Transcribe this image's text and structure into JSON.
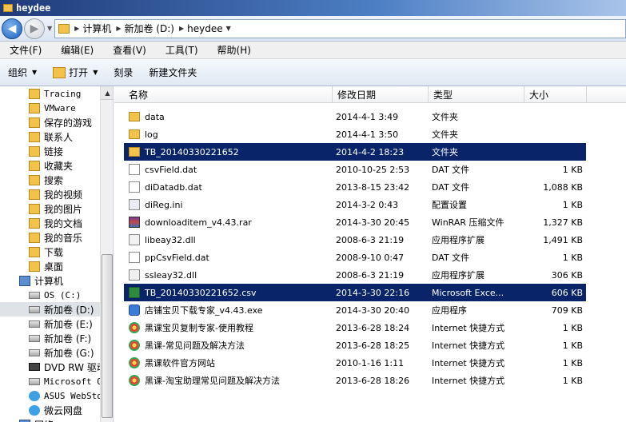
{
  "window": {
    "title": "heydee"
  },
  "address": {
    "crumbs": [
      "计算机",
      "新加卷 (D:)",
      "heydee"
    ]
  },
  "menu": [
    "文件(F)",
    "编辑(E)",
    "查看(V)",
    "工具(T)",
    "帮助(H)"
  ],
  "toolbar": {
    "organize": "组织",
    "open": "打开",
    "burn": "刻录",
    "new_folder": "新建文件夹"
  },
  "nav": [
    {
      "label": "Tracing",
      "icon": "folder-icon",
      "mono": true
    },
    {
      "label": "VMware",
      "icon": "folder-icon",
      "mono": true
    },
    {
      "label": "保存的游戏",
      "icon": "folder-icon"
    },
    {
      "label": "联系人",
      "icon": "folder-icon"
    },
    {
      "label": "链接",
      "icon": "folder-icon"
    },
    {
      "label": "收藏夹",
      "icon": "folder-icon"
    },
    {
      "label": "搜索",
      "icon": "folder-icon"
    },
    {
      "label": "我的视频",
      "icon": "folder-icon"
    },
    {
      "label": "我的图片",
      "icon": "folder-icon"
    },
    {
      "label": "我的文档",
      "icon": "folder-icon"
    },
    {
      "label": "我的音乐",
      "icon": "folder-icon"
    },
    {
      "label": "下载",
      "icon": "folder-icon"
    },
    {
      "label": "桌面",
      "icon": "folder-icon"
    },
    {
      "label": "计算机",
      "icon": "computer-icon"
    },
    {
      "label": "OS (C:)",
      "icon": "drive-icon",
      "mono": true
    },
    {
      "label": "新加卷 (D:)",
      "icon": "drive-icon",
      "selected": true
    },
    {
      "label": "新加卷 (E:)",
      "icon": "drive-icon"
    },
    {
      "label": "新加卷 (F:)",
      "icon": "drive-icon"
    },
    {
      "label": "新加卷 (G:)",
      "icon": "drive-icon"
    },
    {
      "label": "DVD RW 驱动",
      "icon": "dvd-icon"
    },
    {
      "label": "Microsoft O",
      "icon": "drive-icon",
      "mono": true
    },
    {
      "label": "ASUS WebSto",
      "icon": "cloud-icon",
      "mono": true
    },
    {
      "label": "微云网盘",
      "icon": "cloud-icon"
    },
    {
      "label": "网络",
      "icon": "computer-icon"
    }
  ],
  "columns": {
    "name": "名称",
    "date": "修改日期",
    "type": "类型",
    "size": "大小"
  },
  "files": [
    {
      "name": "data",
      "date": "2014-4-1 3:49",
      "type": "文件夹",
      "size": "",
      "icon": "folder"
    },
    {
      "name": "log",
      "date": "2014-4-1 3:50",
      "type": "文件夹",
      "size": "",
      "icon": "folder"
    },
    {
      "name": "TB_20140330221652",
      "date": "2014-4-2 18:23",
      "type": "文件夹",
      "size": "",
      "icon": "folder",
      "selected": true
    },
    {
      "name": "csvField.dat",
      "date": "2010-10-25 2:53",
      "type": "DAT 文件",
      "size": "1 KB",
      "icon": "file"
    },
    {
      "name": "diDatadb.dat",
      "date": "2013-8-15 23:42",
      "type": "DAT 文件",
      "size": "1,088 KB",
      "icon": "file"
    },
    {
      "name": "diReg.ini",
      "date": "2014-3-2 0:43",
      "type": "配置设置",
      "size": "1 KB",
      "icon": "ini"
    },
    {
      "name": "downloaditem_v4.43.rar",
      "date": "2014-3-30 20:45",
      "type": "WinRAR 压缩文件",
      "size": "1,327 KB",
      "icon": "rar"
    },
    {
      "name": "libeay32.dll",
      "date": "2008-6-3 21:19",
      "type": "应用程序扩展",
      "size": "1,491 KB",
      "icon": "dll"
    },
    {
      "name": "ppCsvField.dat",
      "date": "2008-9-10 0:47",
      "type": "DAT 文件",
      "size": "1 KB",
      "icon": "file"
    },
    {
      "name": "ssleay32.dll",
      "date": "2008-6-3 21:19",
      "type": "应用程序扩展",
      "size": "306 KB",
      "icon": "dll"
    },
    {
      "name": "TB_20140330221652.csv",
      "date": "2014-3-30 22:16",
      "type": "Microsoft Exce...",
      "size": "606 KB",
      "icon": "csv",
      "selected": true
    },
    {
      "name": "店铺宝贝下载专家_v4.43.exe",
      "date": "2014-3-30 20:40",
      "type": "应用程序",
      "size": "709 KB",
      "icon": "exe"
    },
    {
      "name": "黑课宝贝复制专家-使用教程",
      "date": "2013-6-28 18:24",
      "type": "Internet 快捷方式",
      "size": "1 KB",
      "icon": "link"
    },
    {
      "name": "黑课-常见问题及解决方法",
      "date": "2013-6-28 18:25",
      "type": "Internet 快捷方式",
      "size": "1 KB",
      "icon": "link"
    },
    {
      "name": "黑课软件官方网站",
      "date": "2010-1-16 1:11",
      "type": "Internet 快捷方式",
      "size": "1 KB",
      "icon": "link"
    },
    {
      "name": "黑课-淘宝助理常见问题及解决方法",
      "date": "2013-6-28 18:26",
      "type": "Internet 快捷方式",
      "size": "1 KB",
      "icon": "link"
    }
  ]
}
